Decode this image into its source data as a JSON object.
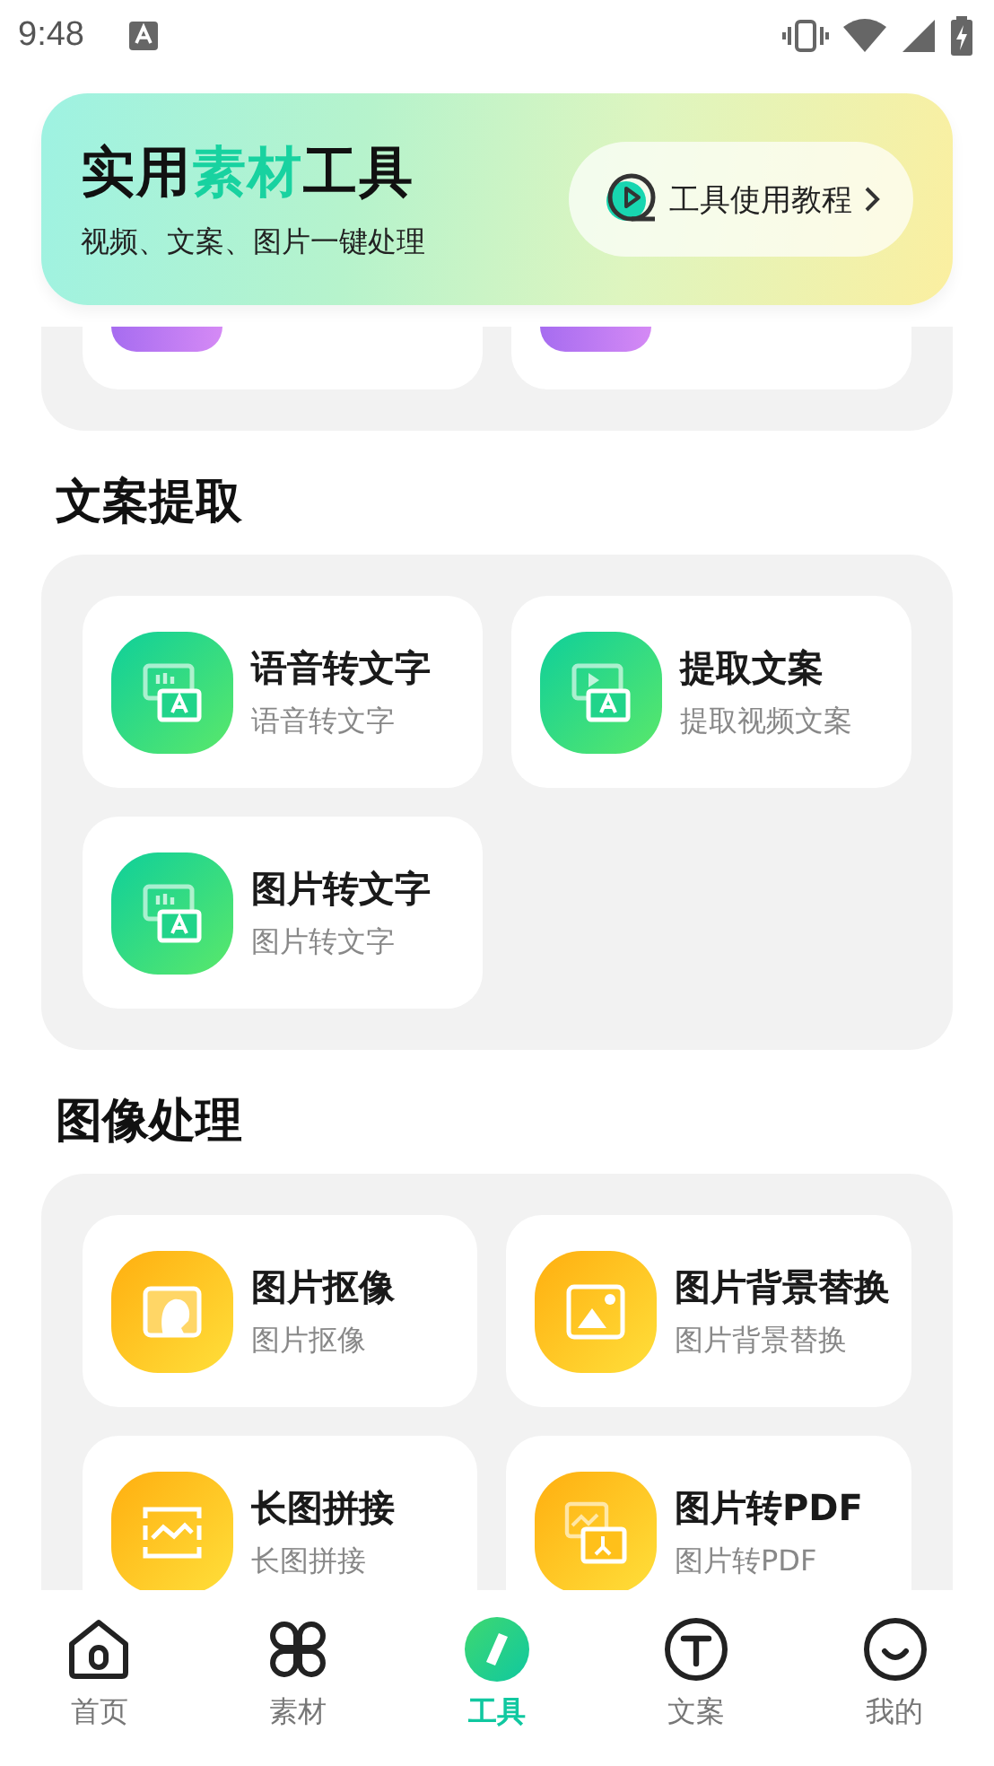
{
  "status_bar": {
    "time": "9:48"
  },
  "banner": {
    "title_parts": [
      {
        "text": "实用",
        "highlight": false
      },
      {
        "text": "素材",
        "highlight": true
      },
      {
        "text": "工具",
        "highlight": false
      }
    ],
    "subtitle": "视频、文案、图片一键处理",
    "tutorial_button": "工具使用教程"
  },
  "sections": [
    {
      "title": "文案提取",
      "kind": "text",
      "tools": [
        {
          "title": "语音转文字",
          "subtitle": "语音转文字"
        },
        {
          "title": "提取文案",
          "subtitle": "提取视频文案"
        },
        {
          "title": "图片转文字",
          "subtitle": "图片转文字"
        }
      ]
    },
    {
      "title": "图像处理",
      "kind": "image",
      "tools": [
        {
          "title": "图片抠像",
          "subtitle": "图片抠像"
        },
        {
          "title": "图片背景替换",
          "subtitle": "图片背景替换"
        },
        {
          "title": "长图拼接",
          "subtitle": "长图拼接"
        },
        {
          "title": "图片转PDF",
          "subtitle": "图片转PDF"
        }
      ]
    }
  ],
  "nav": [
    {
      "label": "首页",
      "selected": false
    },
    {
      "label": "素材",
      "selected": false
    },
    {
      "label": "工具",
      "selected": true
    },
    {
      "label": "文案",
      "selected": false
    },
    {
      "label": "我的",
      "selected": false
    }
  ]
}
